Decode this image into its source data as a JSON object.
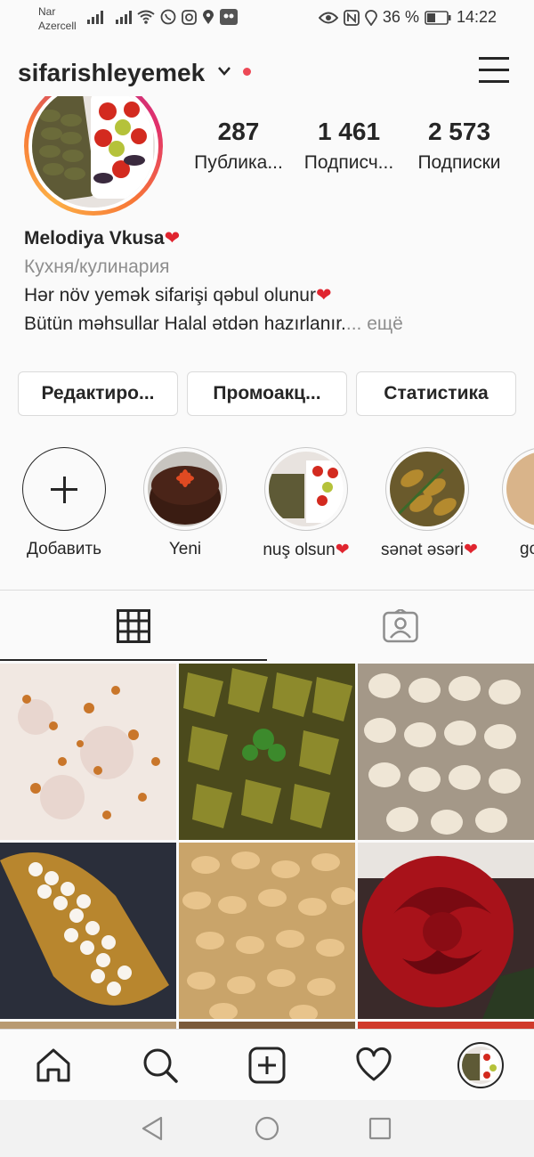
{
  "status_bar": {
    "carrier_line1": "Nar",
    "carrier_line2": "Azercell",
    "battery": "36 %",
    "time": "14:22"
  },
  "header": {
    "username": "sifarishleyemek"
  },
  "profile": {
    "stats": [
      {
        "value": "287",
        "label": "Публика..."
      },
      {
        "value": "1 461",
        "label": "Подписч..."
      },
      {
        "value": "2 573",
        "label": "Подписки"
      }
    ],
    "name": "Melodiya Vkusa",
    "category": "Кухня/кулинария",
    "bio_line1": "Hər növ yemək sifarişi qəbul olunur",
    "bio_line2": "Bütün məhsullar Halal ətdən hazırlanır.",
    "more": "... ещё"
  },
  "buttons": {
    "edit": "Редактиро...",
    "promo": "Промоакц...",
    "stats": "Статистика"
  },
  "highlights": [
    {
      "label": "Добавить"
    },
    {
      "label": "Yeni"
    },
    {
      "label": "nuş olsun"
    },
    {
      "label": "sənət əsəri"
    },
    {
      "label": "go"
    }
  ],
  "colors": {
    "accent_red": "#ed4956",
    "heart": "#e0252f",
    "secondary_text": "#8e8e8e"
  }
}
